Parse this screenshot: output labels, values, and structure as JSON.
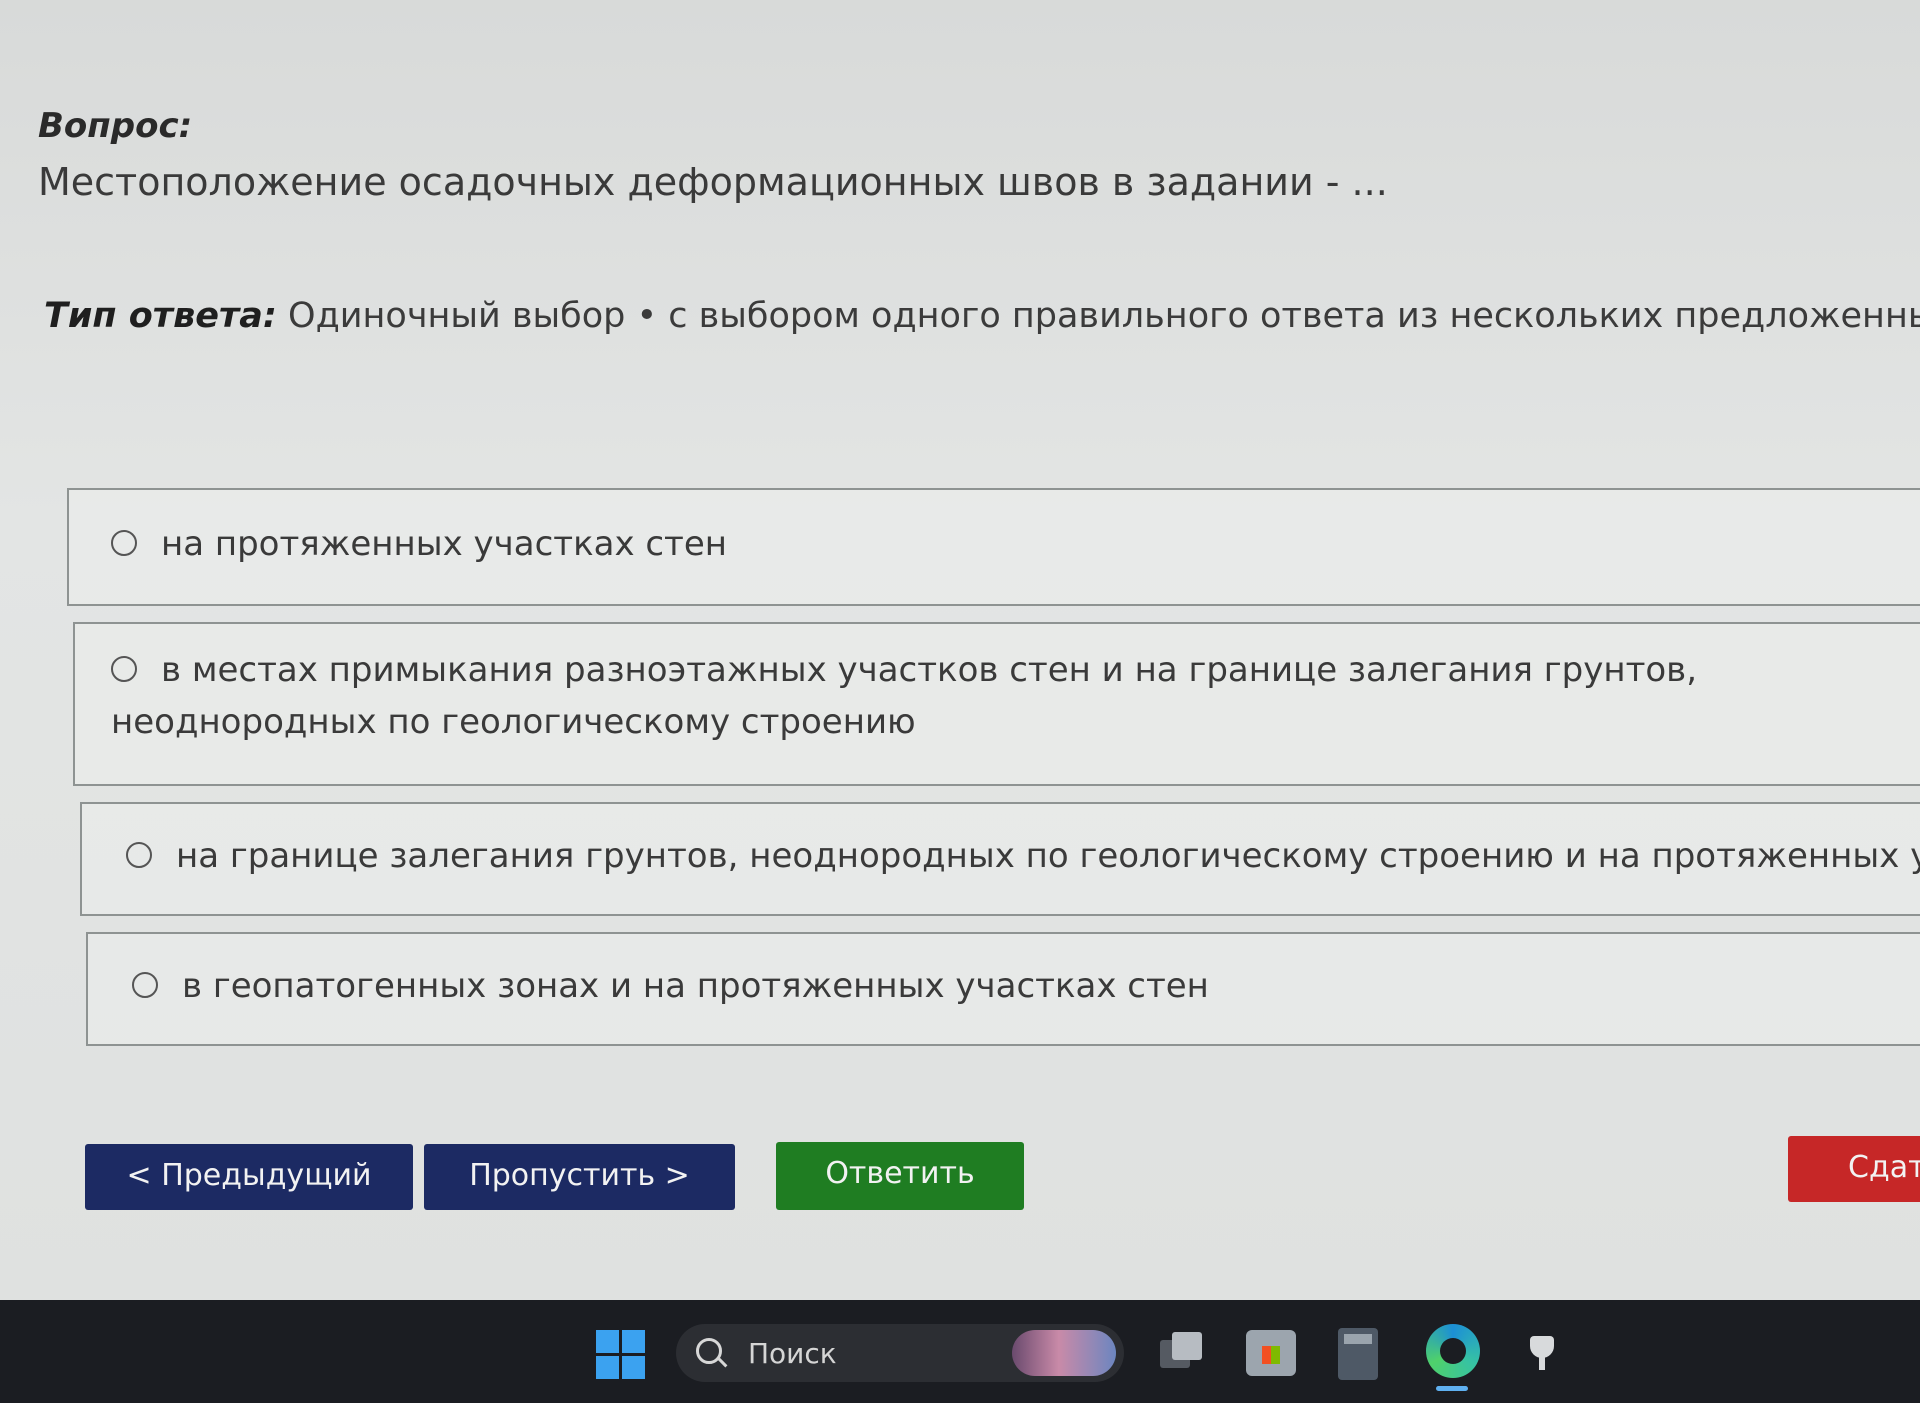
{
  "question": {
    "label": "Вопрос:",
    "text": "Местоположение осадочных деформационных швов в задании - ..."
  },
  "answer_type": {
    "label": "Тип ответа:",
    "value": "Одиночный выбор • с выбором одного правильного ответа из нескольких предложенных вариантов"
  },
  "options": [
    {
      "label": "на протяженных участках стен"
    },
    {
      "label": "в местах примыкания разноэтажных участков стен и на границе залегания грунтов, неоднородных по геологическому строению"
    },
    {
      "label": "на границе залегания грунтов, неоднородных по геологическому строению и на протяженных участках стен"
    },
    {
      "label": "в геопатогенных зонах и на протяженных участках стен"
    }
  ],
  "buttons": {
    "prev": "< Предыдущий",
    "skip": "Пропустить >",
    "answer": "Ответить",
    "submit": "Сдать"
  },
  "colors": {
    "nav_button": "#1c2a63",
    "answer_button": "#1f7d22",
    "submit_button": "#c62727"
  },
  "taskbar": {
    "search_placeholder": "Поиск",
    "icons": [
      "windows-start-icon",
      "search-icon",
      "task-view-icon",
      "store-icon",
      "calculator-icon",
      "edge-icon",
      "pin-icon"
    ]
  }
}
